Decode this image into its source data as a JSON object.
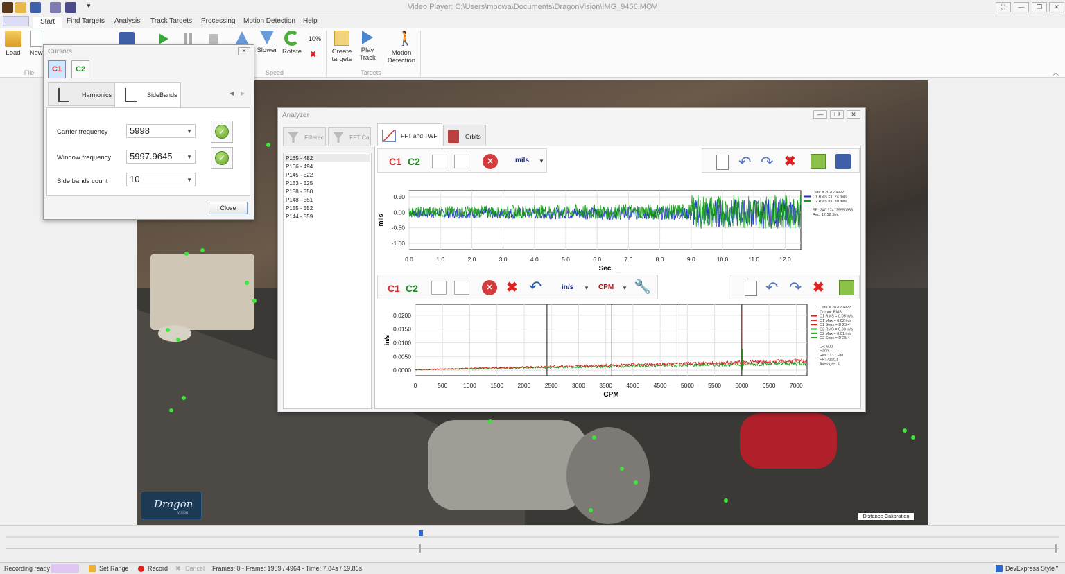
{
  "window": {
    "title": "Video Player: C:\\Users\\mbowa\\Documents\\DragonVision\\IMG_9456.MOV"
  },
  "ribbon": {
    "tabs": [
      "Start",
      "Find Targets",
      "Analysis",
      "Track Targets",
      "Processing",
      "Motion Detection",
      "Help"
    ],
    "buttons": {
      "load": "Load",
      "new": "New",
      "slower": "Slower",
      "rotate": "Rotate",
      "zoom": "10%",
      "create_targets": "Create targets",
      "play_track": "Play Track",
      "motion_detection": "Motion Detection"
    },
    "groups": {
      "file": "File",
      "speed": "Speed",
      "targets": "Targets"
    }
  },
  "cursors": {
    "title": "Cursors",
    "c1": "C1",
    "c2": "C2",
    "tabs": {
      "harmonics": "Harmonics",
      "sidebands": "SideBands"
    },
    "carrier_label": "Carrier frequency",
    "carrier_value": "5998",
    "window_label": "Window frequency",
    "window_value": "5997.9645",
    "count_label": "Side bands count",
    "count_value": "10",
    "close": "Close"
  },
  "analyzer": {
    "title": "Analyzer",
    "left_tabs": [
      "Filterec",
      "FFT Ca"
    ],
    "tabs": {
      "fft": "FFT and TWF",
      "orbits": "Orbits"
    },
    "items": [
      "P165 - 482",
      "P166 - 494",
      "P145 - 522",
      "P153 - 525",
      "P158 - 550",
      "P148 - 551",
      "P155 - 552",
      "P144 - 559"
    ],
    "top_toolbar": {
      "c1": "C1",
      "c2": "C2",
      "units": "mils"
    },
    "bottom_toolbar": {
      "c1": "C1",
      "c2": "C2",
      "units": "in/s",
      "xunits": "CPM"
    }
  },
  "chart_data": [
    {
      "type": "line",
      "title": "",
      "xlabel": "Sec",
      "ylabel": "mils",
      "xlim": [
        0,
        12.5
      ],
      "ylim": [
        -1.2,
        0.7
      ],
      "x_ticks": [
        "0.0",
        "1.0",
        "2.0",
        "3.0",
        "4.0",
        "5.0",
        "6.0",
        "7.0",
        "8.0",
        "9.0",
        "10.0",
        "11.0",
        "12.0"
      ],
      "y_ticks": [
        "0.50",
        "0.00",
        "-0.50",
        "-1.00"
      ],
      "series": [
        {
          "name": "C1 RMS = 0.24 mils",
          "color": "#1a2ecc"
        },
        {
          "name": "C2 RMS = 0.30 mils",
          "color": "#169c16"
        }
      ],
      "legend_text": [
        "Date = 2020/04/27",
        "C1 RMS = 0.24 mils",
        "C2 RMS = 0.30 mils",
        "SR: 240.174179550933",
        "Rec: 12.52 Sec"
      ]
    },
    {
      "type": "line",
      "title": "",
      "xlabel": "CPM",
      "ylabel": "in/s",
      "xlim": [
        0,
        7200
      ],
      "ylim": [
        -0.002,
        0.024
      ],
      "x_ticks": [
        "0",
        "500",
        "1000",
        "1500",
        "2000",
        "2500",
        "3000",
        "3500",
        "4000",
        "4500",
        "5000",
        "5500",
        "6000",
        "6500",
        "7000"
      ],
      "y_ticks": [
        "0.0200",
        "0.0150",
        "0.0100",
        "0.0050",
        "0.0000"
      ],
      "cursor_lines_cpm": [
        2420,
        3610,
        4810,
        6000
      ],
      "peak": {
        "x": 5998,
        "y": 0.022
      },
      "series": [
        {
          "name": "C1 RMS = 0.05 in/s",
          "color": "#d32020"
        },
        {
          "name": "C2 RMS = 0.03 in/s",
          "color": "#169c16"
        }
      ],
      "legend_text": [
        "Date = 2020/04/27",
        "Output: RMS",
        "C1 RMS = 0.05 in/s",
        "C1 Max = 0.02 in/s",
        "C1 Sens = D 25.4",
        "C2 RMS = 0.03 in/s",
        "C2 Max = 0.01 in/s",
        "C2 Sens = D 25.4",
        "LR: 600",
        "Hann",
        "Res.: 13 CPM",
        "FR: 7200.1",
        "Averages: 1"
      ]
    }
  ],
  "video": {
    "distance_button": "Distance Calibration",
    "logo_text": "Dragon",
    "logo_sub": "vision"
  },
  "status": {
    "ready": "Recording ready",
    "set_range": "Set Range",
    "record": "Record",
    "cancel": "Cancel",
    "frames": "Frames: 0 - Frame: 1959 / 4964 - Time: 7.84s / 19.86s",
    "style": "DevExpress Style"
  }
}
